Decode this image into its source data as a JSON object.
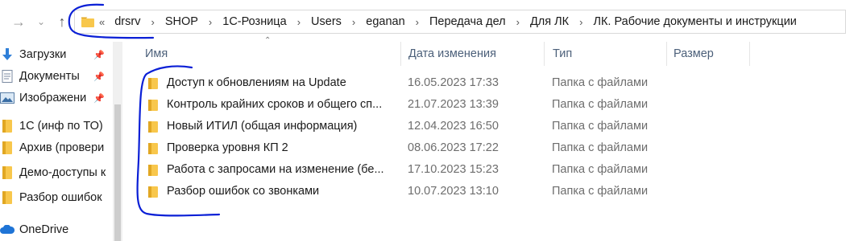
{
  "address": {
    "breadcrumbs": [
      "drsrv",
      "SHOP",
      "1С-Розница",
      "Users",
      "eganan",
      "Передача дел",
      "Для ЛК",
      "ЛК. Рабочие документы и инструкции"
    ]
  },
  "sidebar": {
    "items": [
      {
        "label": "Загрузки",
        "icon": "download-arrow-icon",
        "pinned": true
      },
      {
        "label": "Документы",
        "icon": "document-icon",
        "pinned": true
      },
      {
        "label": "Изображени",
        "icon": "picture-icon",
        "pinned": true
      },
      {
        "label": "1С (инф по ТО)",
        "icon": "folder-icon",
        "pinned": false
      },
      {
        "label": "Архив (провери",
        "icon": "folder-icon",
        "pinned": false
      },
      {
        "label": "Демо-доступы к",
        "icon": "folder-icon",
        "pinned": false
      },
      {
        "label": "Разбор ошибок",
        "icon": "folder-icon",
        "pinned": false
      },
      {
        "label": "OneDrive",
        "icon": "cloud-icon",
        "pinned": false
      }
    ]
  },
  "columns": {
    "name": "Имя",
    "date": "Дата изменения",
    "type": "Тип",
    "size": "Размер"
  },
  "files": [
    {
      "name": "Доступ к обновлениям на Update",
      "date": "16.05.2023 17:33",
      "type": "Папка с файлами"
    },
    {
      "name": "Контроль крайних сроков и общего сп...",
      "date": "21.07.2023 13:39",
      "type": "Папка с файлами"
    },
    {
      "name": "Новый ИТИЛ (общая информация)",
      "date": "12.04.2023 16:50",
      "type": "Папка с файлами"
    },
    {
      "name": "Проверка уровня КП 2",
      "date": "08.06.2023 17:22",
      "type": "Папка с файлами"
    },
    {
      "name": "Работа с запросами на изменение (бе...",
      "date": "17.10.2023 15:23",
      "type": "Папка с файлами"
    },
    {
      "name": "Разбор ошибок со звонками",
      "date": "10.07.2023 13:10",
      "type": "Папка с файлами"
    }
  ],
  "colors": {
    "folder": "#f8c74c",
    "folder_dark": "#e1a723",
    "ink": "#0a1fd6",
    "header_text": "#4c607a"
  }
}
